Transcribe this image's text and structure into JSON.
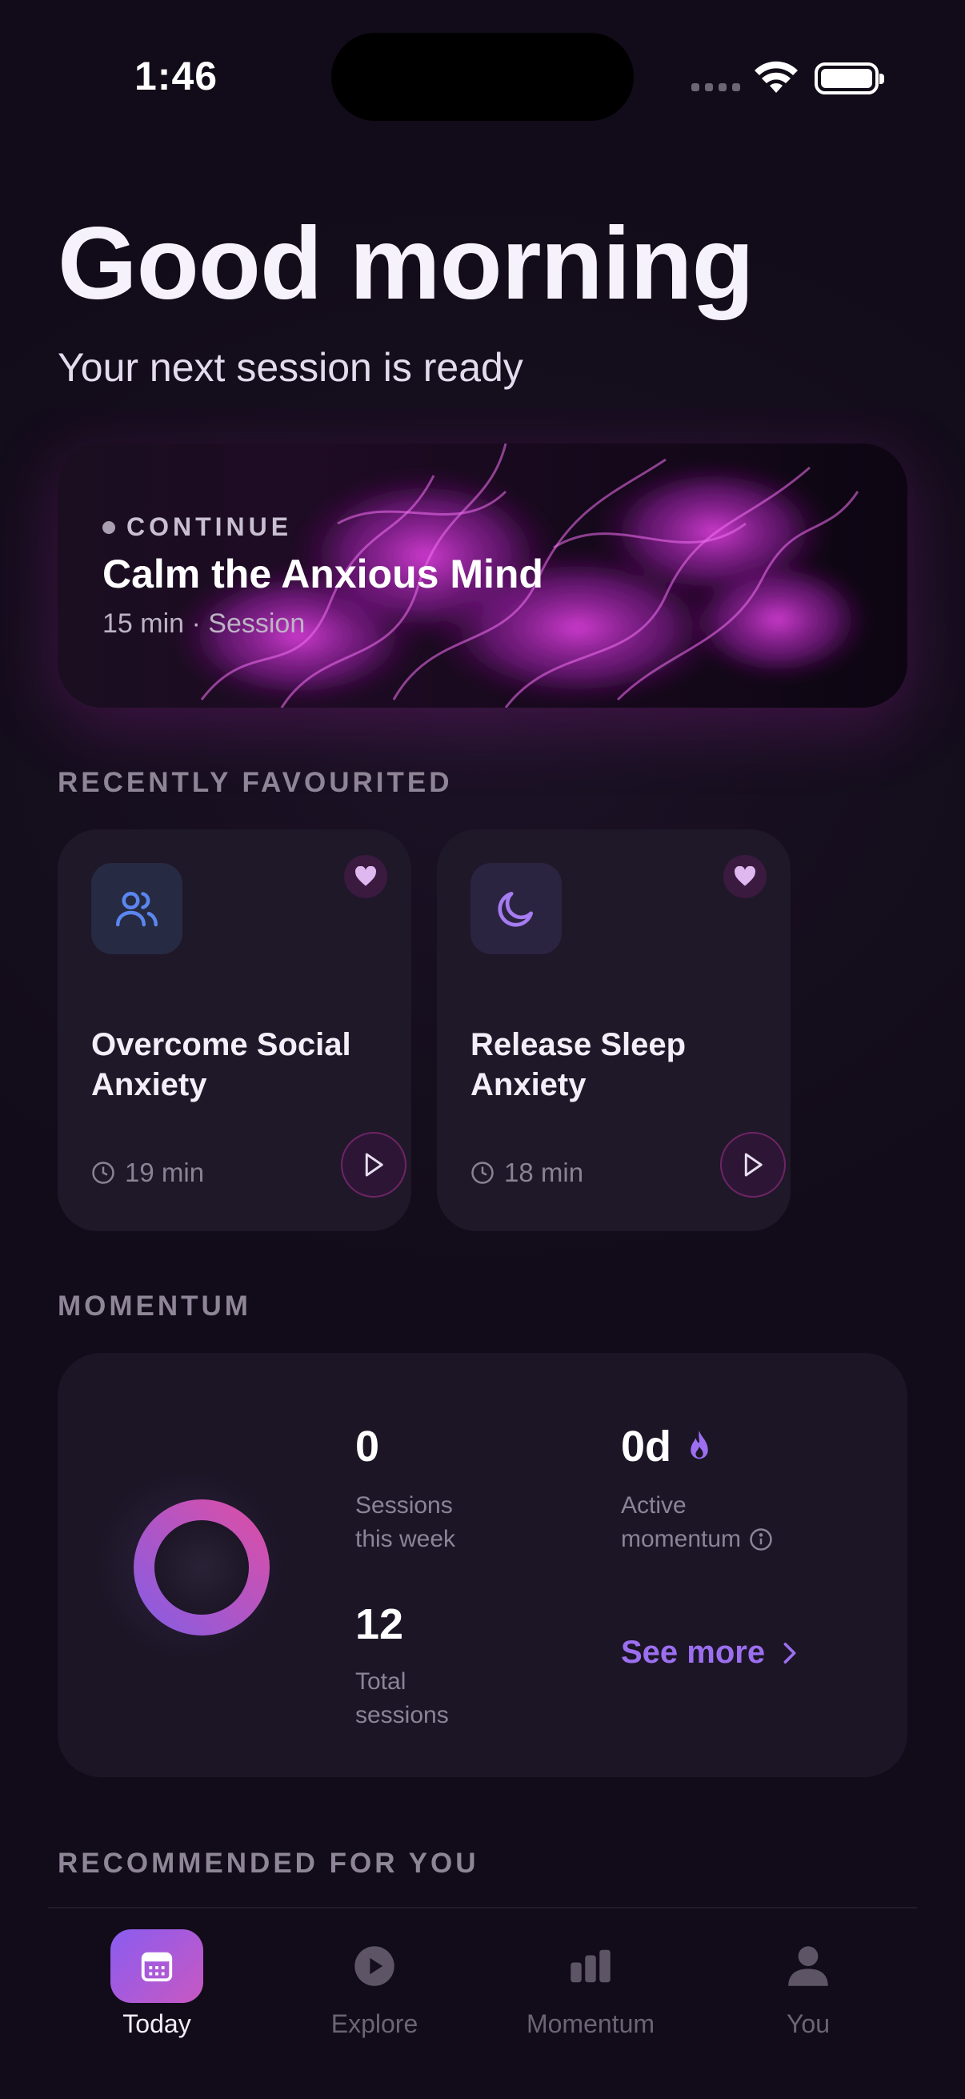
{
  "status_bar": {
    "time": "1:46"
  },
  "greeting": {
    "title": "Good morning",
    "subtitle": "Your next session is ready"
  },
  "continue_card": {
    "label": "CONTINUE",
    "title": "Calm the Anxious Mind",
    "meta": "15 min · Session"
  },
  "favourites": {
    "header": "RECENTLY FAVOURITED",
    "items": [
      {
        "title": "Overcome Social Anxiety",
        "duration": "19 min",
        "icon": "people-icon",
        "favourited": true
      },
      {
        "title": "Release Sleep Anxiety",
        "duration": "18 min",
        "icon": "moon-icon",
        "favourited": true
      }
    ]
  },
  "momentum": {
    "header": "MOMENTUM",
    "sessions_this_week": {
      "value": "0",
      "label_line1": "Sessions",
      "label_line2": "this week"
    },
    "active_momentum": {
      "value": "0d",
      "label_line1": "Active",
      "label_line2": "momentum",
      "icon": "flame-icon"
    },
    "total_sessions": {
      "value": "12",
      "label_line1": "Total",
      "label_line2": "sessions"
    },
    "see_more": "See more"
  },
  "recommended": {
    "header": "RECOMMENDED FOR YOU"
  },
  "tabs": [
    {
      "label": "Today",
      "icon": "calendar-icon",
      "active": true
    },
    {
      "label": "Explore",
      "icon": "play-circle-icon",
      "active": false
    },
    {
      "label": "Momentum",
      "icon": "bar-chart-icon",
      "active": false
    },
    {
      "label": "You",
      "icon": "person-icon",
      "active": false
    }
  ],
  "colors": {
    "background": "#150e1d",
    "accent": "#9c6ff0",
    "heart": "#e0b8f0",
    "ring_start": "#d94fa8",
    "ring_end": "#8a5ce0"
  }
}
